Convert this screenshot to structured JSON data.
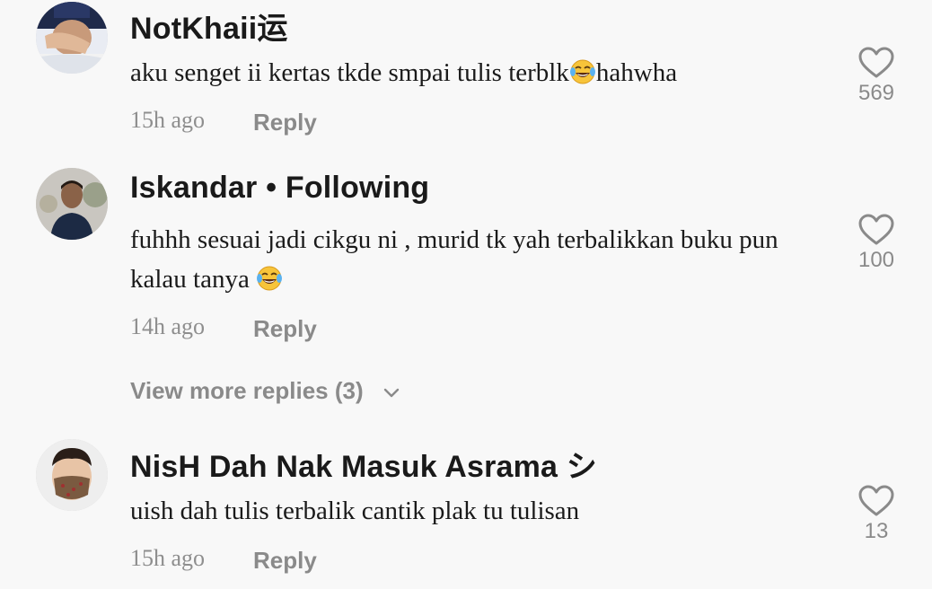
{
  "comments": [
    {
      "username": "NotKhaii运",
      "text_before_emoji": "aku senget ii kertas tkde smpai tulis terblk",
      "text_after_emoji": "hahwha",
      "emoji": "face-with-tears-of-joy",
      "time": "15h ago",
      "reply_label": "Reply",
      "likes": "569"
    },
    {
      "username": "Iskandar • Following",
      "text_before_emoji": "fuhhh sesuai jadi cikgu ni , murid tk yah terbalikkan buku pun kalau tanya ",
      "text_after_emoji": "",
      "emoji": "face-with-tears-of-joy",
      "time": "14h ago",
      "reply_label": "Reply",
      "likes": "100",
      "view_more_label": "View more replies (3)"
    },
    {
      "username": "NisH Dah Nak Masuk Asrama シ",
      "text": "uish dah tulis terbalik cantik plak tu tulisan",
      "time": "15h ago",
      "reply_label": "Reply",
      "likes": "13"
    }
  ],
  "icons": {
    "like": "heart-outline-icon",
    "expand": "chevron-down-icon",
    "emoji": "face-with-tears-of-joy"
  },
  "colors": {
    "background": "#f8f8f8",
    "username": "#1a1a1a",
    "secondary_text": "#8a8a8a"
  }
}
